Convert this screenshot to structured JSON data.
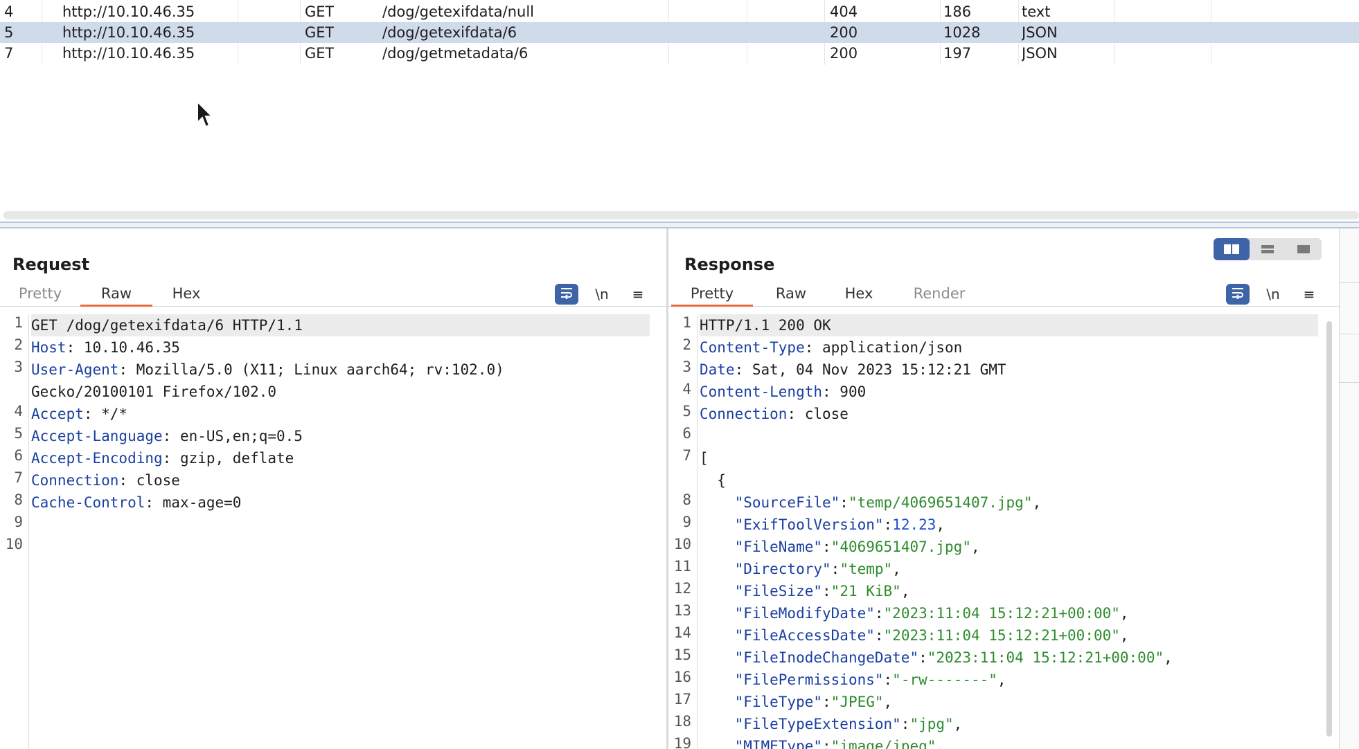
{
  "history": {
    "rows": [
      {
        "num": "4",
        "host": "http://10.10.46.35",
        "method": "GET",
        "url": "/dog/getexifdata/null",
        "status": "404",
        "length": "186",
        "mime": "text",
        "selected": false
      },
      {
        "num": "5",
        "host": "http://10.10.46.35",
        "method": "GET",
        "url": "/dog/getexifdata/6",
        "status": "200",
        "length": "1028",
        "mime": "JSON",
        "selected": true
      },
      {
        "num": "7",
        "host": "http://10.10.46.35",
        "method": "GET",
        "url": "/dog/getmetadata/6",
        "status": "200",
        "length": "197",
        "mime": "JSON",
        "selected": false
      }
    ]
  },
  "request": {
    "title": "Request",
    "tabs": [
      "Pretty",
      "Raw",
      "Hex"
    ],
    "active_tab": "Raw",
    "wrap_icon": "wrap-lines-icon",
    "newline_label": "\\n",
    "menu_icon": "hamburger-menu-icon",
    "line_numbers": [
      "1",
      "2",
      "3",
      "",
      "4",
      "5",
      "6",
      "7",
      "8",
      "9",
      "10"
    ],
    "lines": [
      {
        "parts": [
          {
            "t": "v",
            "text": "GET /dog/getexifdata/6 HTTP/1.1"
          }
        ]
      },
      {
        "parts": [
          {
            "t": "k",
            "text": "Host"
          },
          {
            "t": "v",
            "text": ": 10.10.46.35"
          }
        ]
      },
      {
        "parts": [
          {
            "t": "k",
            "text": "User-Agent"
          },
          {
            "t": "v",
            "text": ": Mozilla/5.0 (X11; Linux aarch64; rv:102.0)"
          }
        ]
      },
      {
        "parts": [
          {
            "t": "v",
            "text": "Gecko/20100101 Firefox/102.0"
          }
        ]
      },
      {
        "parts": [
          {
            "t": "k",
            "text": "Accept"
          },
          {
            "t": "v",
            "text": ": */*"
          }
        ]
      },
      {
        "parts": [
          {
            "t": "k",
            "text": "Accept-Language"
          },
          {
            "t": "v",
            "text": ": en-US,en;q=0.5"
          }
        ]
      },
      {
        "parts": [
          {
            "t": "k",
            "text": "Accept-Encoding"
          },
          {
            "t": "v",
            "text": ": gzip, deflate"
          }
        ]
      },
      {
        "parts": [
          {
            "t": "k",
            "text": "Connection"
          },
          {
            "t": "v",
            "text": ": close"
          }
        ]
      },
      {
        "parts": [
          {
            "t": "k",
            "text": "Cache-Control"
          },
          {
            "t": "v",
            "text": ": max-age=0"
          }
        ]
      },
      {
        "parts": []
      },
      {
        "parts": []
      }
    ]
  },
  "response": {
    "title": "Response",
    "tabs": [
      "Pretty",
      "Raw",
      "Hex",
      "Render"
    ],
    "active_tab": "Pretty",
    "wrap_icon": "wrap-lines-icon",
    "newline_label": "\\n",
    "menu_icon": "hamburger-menu-icon",
    "line_numbers": [
      "1",
      "2",
      "3",
      "4",
      "5",
      "6",
      "7",
      "",
      "8",
      "9",
      "10",
      "11",
      "12",
      "13",
      "14",
      "15",
      "16",
      "17",
      "18",
      "19"
    ],
    "lines": [
      {
        "parts": [
          {
            "t": "v",
            "text": "HTTP/1.1 200 OK"
          }
        ]
      },
      {
        "parts": [
          {
            "t": "k",
            "text": "Content-Type"
          },
          {
            "t": "v",
            "text": ": application/json"
          }
        ]
      },
      {
        "parts": [
          {
            "t": "k",
            "text": "Date"
          },
          {
            "t": "v",
            "text": ": Sat, 04 Nov 2023 15:12:21 GMT"
          }
        ]
      },
      {
        "parts": [
          {
            "t": "k",
            "text": "Content-Length"
          },
          {
            "t": "v",
            "text": ": 900"
          }
        ]
      },
      {
        "parts": [
          {
            "t": "k",
            "text": "Connection"
          },
          {
            "t": "v",
            "text": ": close"
          }
        ]
      },
      {
        "parts": []
      },
      {
        "parts": [
          {
            "t": "v",
            "text": "["
          }
        ]
      },
      {
        "parts": [
          {
            "t": "v",
            "text": "  {"
          }
        ]
      },
      {
        "parts": [
          {
            "t": "v",
            "text": "    "
          },
          {
            "t": "k",
            "text": "\"SourceFile\""
          },
          {
            "t": "v",
            "text": ":"
          },
          {
            "t": "s",
            "text": "\"temp/4069651407.jpg\""
          },
          {
            "t": "v",
            "text": ","
          }
        ]
      },
      {
        "parts": [
          {
            "t": "v",
            "text": "    "
          },
          {
            "t": "k",
            "text": "\"ExifToolVersion\""
          },
          {
            "t": "v",
            "text": ":"
          },
          {
            "t": "n",
            "text": "12.23"
          },
          {
            "t": "v",
            "text": ","
          }
        ]
      },
      {
        "parts": [
          {
            "t": "v",
            "text": "    "
          },
          {
            "t": "k",
            "text": "\"FileName\""
          },
          {
            "t": "v",
            "text": ":"
          },
          {
            "t": "s",
            "text": "\"4069651407.jpg\""
          },
          {
            "t": "v",
            "text": ","
          }
        ]
      },
      {
        "parts": [
          {
            "t": "v",
            "text": "    "
          },
          {
            "t": "k",
            "text": "\"Directory\""
          },
          {
            "t": "v",
            "text": ":"
          },
          {
            "t": "s",
            "text": "\"temp\""
          },
          {
            "t": "v",
            "text": ","
          }
        ]
      },
      {
        "parts": [
          {
            "t": "v",
            "text": "    "
          },
          {
            "t": "k",
            "text": "\"FileSize\""
          },
          {
            "t": "v",
            "text": ":"
          },
          {
            "t": "s",
            "text": "\"21 KiB\""
          },
          {
            "t": "v",
            "text": ","
          }
        ]
      },
      {
        "parts": [
          {
            "t": "v",
            "text": "    "
          },
          {
            "t": "k",
            "text": "\"FileModifyDate\""
          },
          {
            "t": "v",
            "text": ":"
          },
          {
            "t": "s",
            "text": "\"2023:11:04 15:12:21+00:00\""
          },
          {
            "t": "v",
            "text": ","
          }
        ]
      },
      {
        "parts": [
          {
            "t": "v",
            "text": "    "
          },
          {
            "t": "k",
            "text": "\"FileAccessDate\""
          },
          {
            "t": "v",
            "text": ":"
          },
          {
            "t": "s",
            "text": "\"2023:11:04 15:12:21+00:00\""
          },
          {
            "t": "v",
            "text": ","
          }
        ]
      },
      {
        "parts": [
          {
            "t": "v",
            "text": "    "
          },
          {
            "t": "k",
            "text": "\"FileInodeChangeDate\""
          },
          {
            "t": "v",
            "text": ":"
          },
          {
            "t": "s",
            "text": "\"2023:11:04 15:12:21+00:00\""
          },
          {
            "t": "v",
            "text": ","
          }
        ]
      },
      {
        "parts": [
          {
            "t": "v",
            "text": "    "
          },
          {
            "t": "k",
            "text": "\"FilePermissions\""
          },
          {
            "t": "v",
            "text": ":"
          },
          {
            "t": "s",
            "text": "\"-rw-------\""
          },
          {
            "t": "v",
            "text": ","
          }
        ]
      },
      {
        "parts": [
          {
            "t": "v",
            "text": "    "
          },
          {
            "t": "k",
            "text": "\"FileType\""
          },
          {
            "t": "v",
            "text": ":"
          },
          {
            "t": "s",
            "text": "\"JPEG\""
          },
          {
            "t": "v",
            "text": ","
          }
        ]
      },
      {
        "parts": [
          {
            "t": "v",
            "text": "    "
          },
          {
            "t": "k",
            "text": "\"FileTypeExtension\""
          },
          {
            "t": "v",
            "text": ":"
          },
          {
            "t": "s",
            "text": "\"jpg\""
          },
          {
            "t": "v",
            "text": ","
          }
        ]
      },
      {
        "parts": [
          {
            "t": "v",
            "text": "    "
          },
          {
            "t": "k",
            "text": "\"MIMEType\""
          },
          {
            "t": "v",
            "text": ":"
          },
          {
            "t": "s",
            "text": "\"image/jpeg\""
          },
          {
            "t": "v",
            "text": ","
          }
        ]
      }
    ]
  },
  "layout_toggle": {
    "options": [
      "split-horizontal-icon",
      "split-vertical-icon",
      "single-pane-icon"
    ],
    "active": "split-horizontal-icon"
  },
  "colors": {
    "accent_tab": "#e8683f",
    "selected_row": "#cfdaea",
    "button_blue": "#3e63a6",
    "header_name": "#1a3fa1",
    "json_string": "#2e8b2e",
    "json_number": "#1f4bd1"
  }
}
